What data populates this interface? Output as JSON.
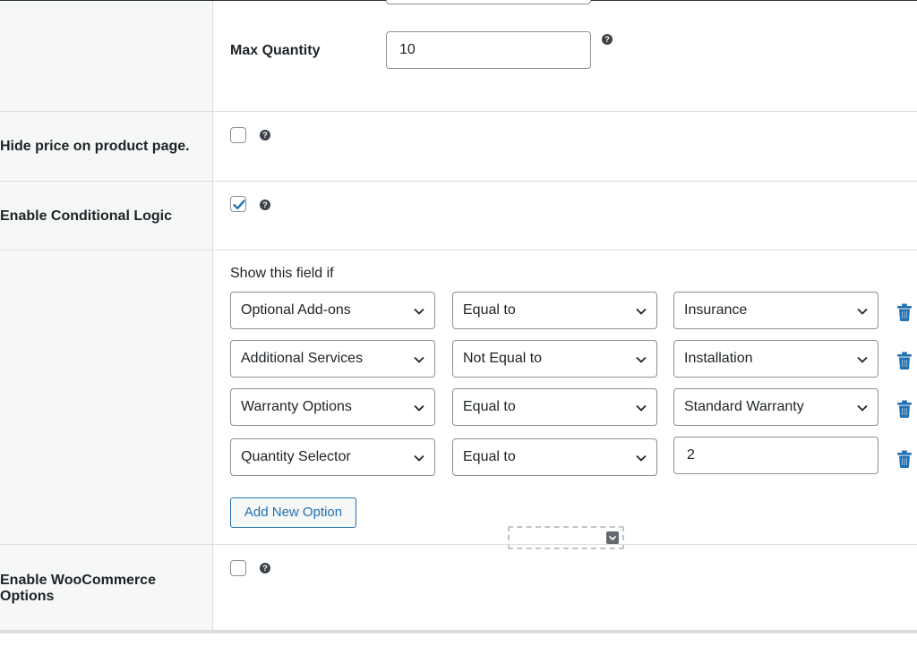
{
  "fields": {
    "max_quantity": {
      "label": "Max Quantity",
      "value": "10"
    },
    "hide_price": {
      "label": "Hide price on product page.",
      "checked": false
    },
    "enable_conditional_logic": {
      "label": "Enable Conditional Logic",
      "checked": true
    },
    "enable_woocommerce_options": {
      "label_line1": "Enable WooCommerce",
      "label_line2": "Options",
      "checked": false
    }
  },
  "help_icon_glyph": "?",
  "conditional": {
    "heading": "Show this field if",
    "rules": [
      {
        "field": "Optional Add-ons",
        "operator": "Equal to",
        "value": "Insurance",
        "value_type": "select"
      },
      {
        "field": "Additional Services",
        "operator": "Not Equal to",
        "value": "Installation",
        "value_type": "select"
      },
      {
        "field": "Warranty Options",
        "operator": "Equal to",
        "value": "Standard Warranty",
        "value_type": "select"
      },
      {
        "field": "Quantity Selector",
        "operator": "Equal to",
        "value": "2",
        "value_type": "text"
      }
    ],
    "add_button_label": "Add New Option"
  },
  "colors": {
    "accent": "#2271b1",
    "label_background": "#f6f7f7",
    "border": "#dcdcde",
    "text": "#1d2327"
  },
  "icons": {
    "help": "question-mark-circle-icon",
    "delete": "trash-icon",
    "dropdown": "chevron-down-icon",
    "checkmark": "checkmark-icon"
  }
}
